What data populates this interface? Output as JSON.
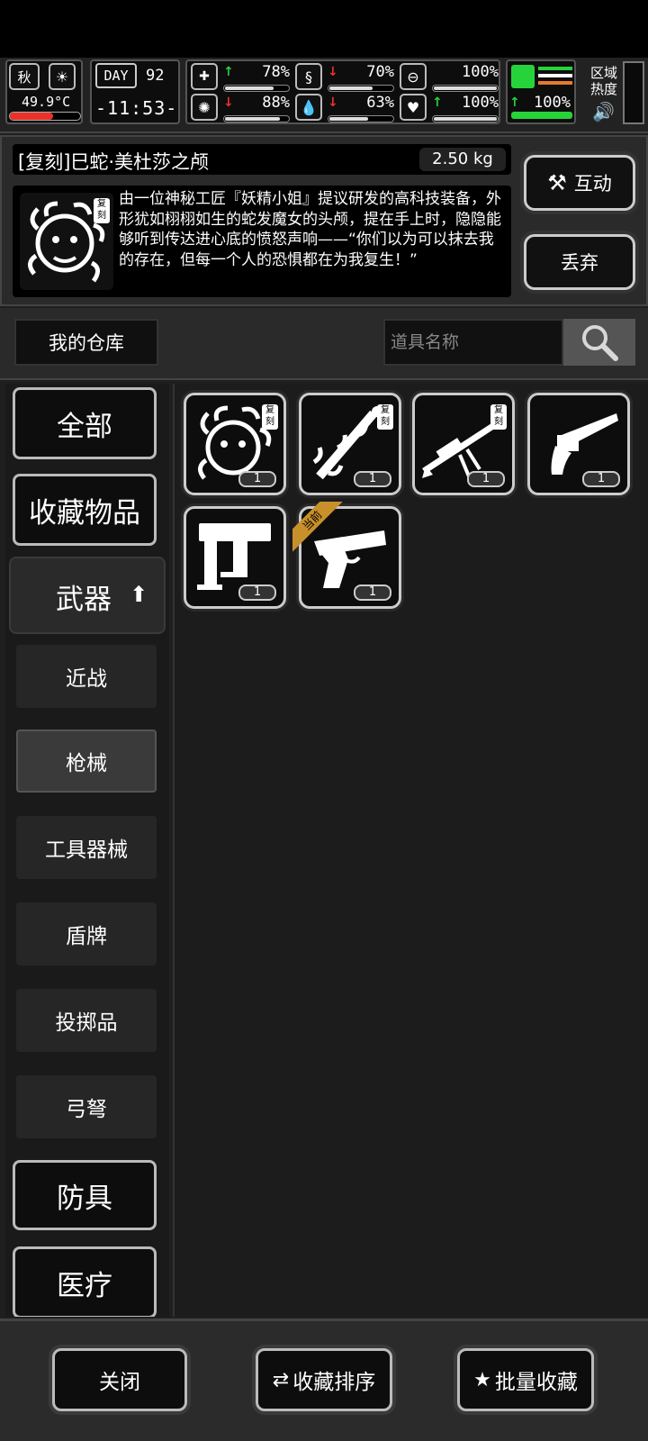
{
  "hud": {
    "season": "秋",
    "temperature": "49.9°C",
    "day_label": "DAY",
    "day_number": "92",
    "clock": "-11:53-",
    "stats": [
      {
        "name": "health",
        "value": "78%",
        "level": 0.78,
        "trend": "up",
        "trend_color": "#27d33a"
      },
      {
        "name": "hunger",
        "value": "70%",
        "level": 0.7,
        "trend": "down",
        "trend_color": "#e8322b"
      },
      {
        "name": "stamina",
        "value": "100%",
        "level": 1.0,
        "trend": "none",
        "trend_color": "#ffffff"
      },
      {
        "name": "mind",
        "value": "88%",
        "level": 0.88,
        "trend": "down",
        "trend_color": "#e8322b"
      },
      {
        "name": "thirst",
        "value": "63%",
        "level": 0.63,
        "trend": "down",
        "trend_color": "#e8322b"
      },
      {
        "name": "heart",
        "value": "100%",
        "level": 1.0,
        "trend": "up",
        "trend_color": "#27d33a"
      }
    ],
    "leg_value": "100%",
    "zone_heat_label": "区域热度"
  },
  "item": {
    "title": "[复刻]巳蛇·美杜莎之颅",
    "weight": "2.50 kg",
    "badge": "复刻",
    "description": "由一位神秘工匠『妖精小姐』提议研发的高科技装备，外形犹如栩栩如生的蛇发魔女的头颅，提在手上时，隐隐能够听到传达进心底的愤怒声响——“你们以为可以抹去我的存在，但每一个人的恐惧都在为我复生！”"
  },
  "actions": {
    "interact": "互动",
    "discard": "丢弃"
  },
  "warehouse": {
    "label": "我的仓库",
    "search_placeholder": "道具名称"
  },
  "sidebar": {
    "all": "全部",
    "favorites": "收藏物品",
    "weapons": "武器",
    "sub": [
      "近战",
      "枪械",
      "工具器械",
      "盾牌",
      "投掷品",
      "弓弩"
    ],
    "armor": "防具",
    "medical": "医疗"
  },
  "grid": {
    "items": [
      {
        "icon": "medusa-head-icon",
        "qty": "1",
        "badge": "复刻"
      },
      {
        "icon": "snake-blade-icon",
        "qty": "1",
        "badge": "复刻"
      },
      {
        "icon": "sniper-rifle-icon",
        "qty": "1",
        "badge": "复刻"
      },
      {
        "icon": "revolver-icon",
        "qty": "1"
      },
      {
        "icon": "nail-gun-icon",
        "qty": "1"
      },
      {
        "icon": "desert-eagle-icon",
        "qty": "1",
        "ribbon": "当前"
      }
    ]
  },
  "footer": {
    "close": "关闭",
    "sort": "收藏排序",
    "batch": "批量收藏"
  },
  "colors": {
    "accent_green": "#27d33a",
    "accent_red": "#e8322b",
    "ribbon_gold": "#c8902a"
  }
}
